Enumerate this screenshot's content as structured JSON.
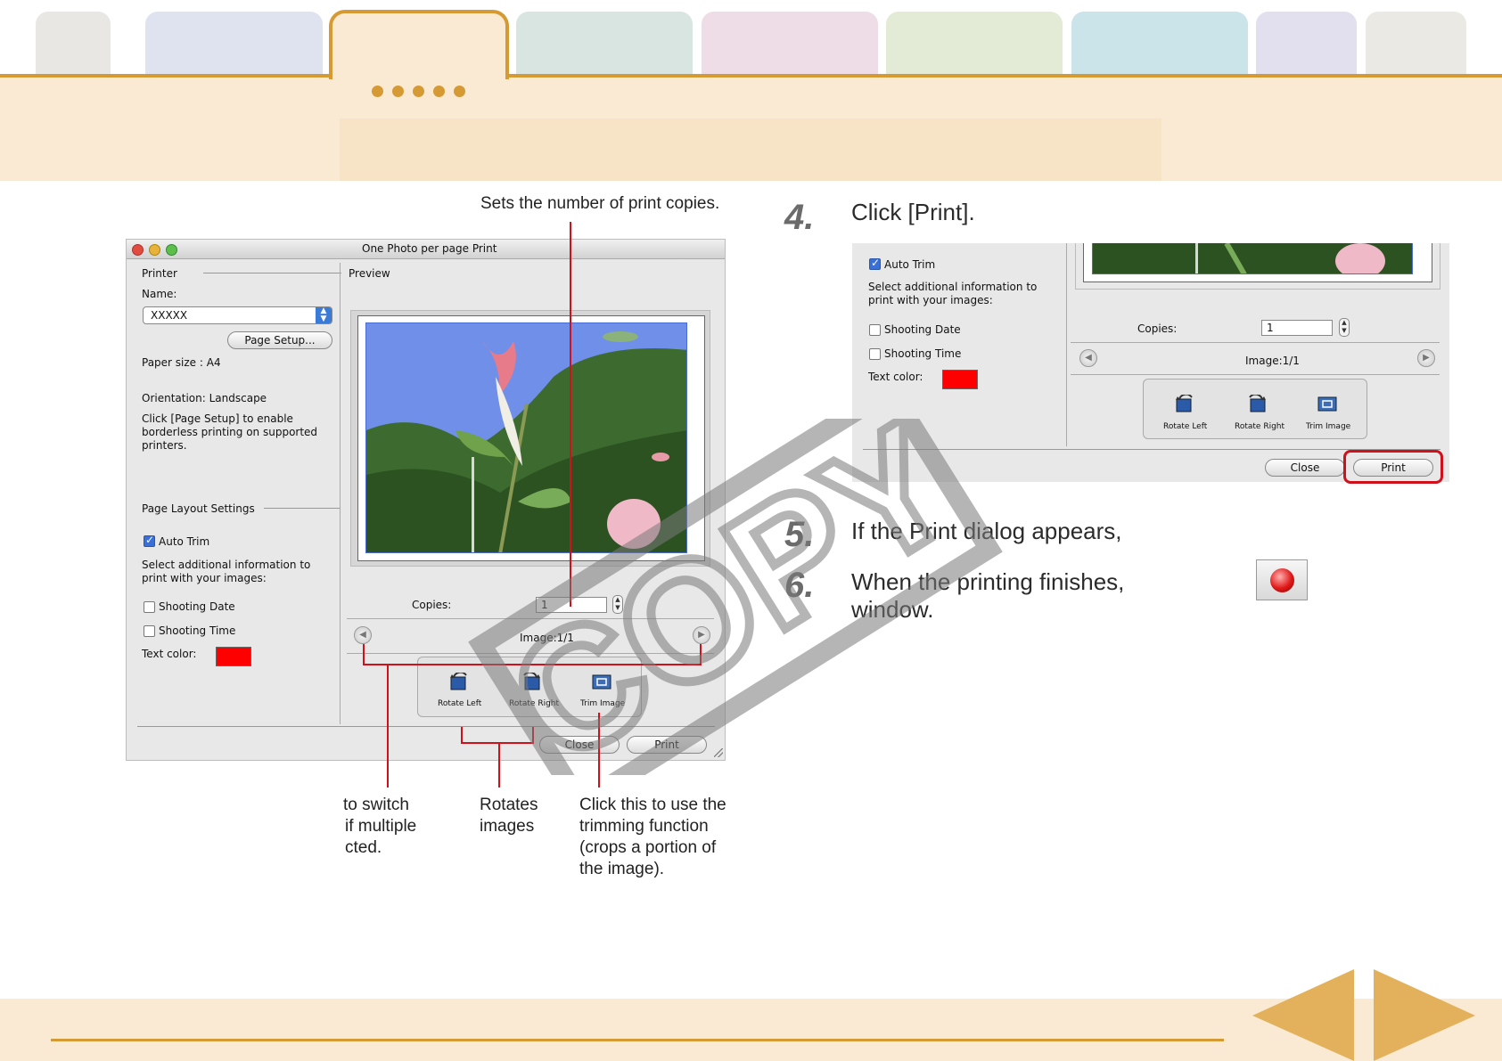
{
  "header": {
    "tabs": [
      {
        "name": "tab-1",
        "color": "#e9e7e3"
      },
      {
        "name": "tab-2",
        "color": "#dfe3ef"
      },
      {
        "name": "tab-active",
        "color": "#faead4"
      },
      {
        "name": "tab-4",
        "color": "#d8e5e0"
      },
      {
        "name": "tab-5",
        "color": "#eedde7"
      },
      {
        "name": "tab-6",
        "color": "#e3ead6"
      },
      {
        "name": "tab-7",
        "color": "#cbe4ea"
      },
      {
        "name": "tab-8",
        "color": "#e2e0ee"
      },
      {
        "name": "tab-9",
        "color": "#ebe9e3"
      }
    ],
    "accent": "#d69a34"
  },
  "dialog": {
    "title": "One Photo per page Print",
    "printer_section": "Printer",
    "name_label": "Name:",
    "printer_value": "XXXXX",
    "page_setup_button": "Page Setup...",
    "paper_size": "Paper size :  A4",
    "orientation": "Orientation: Landscape",
    "borderless_note": "Click [Page Setup] to enable borderless printing on supported printers.",
    "layout_section": "Page Layout Settings",
    "auto_trim": "Auto Trim",
    "additional_info": "Select additional information to print with your images:",
    "shooting_date": "Shooting Date",
    "shooting_time": "Shooting Time",
    "text_color": "Text color:",
    "preview_label": "Preview",
    "copies_label": "Copies:",
    "copies_value": "1",
    "image_counter": "Image:1/1",
    "rotate_left": "Rotate Left",
    "rotate_right": "Rotate Right",
    "trim_image": "Trim Image",
    "close_button": "Close",
    "print_button": "Print"
  },
  "callouts": {
    "copies": "Sets the number of print copies.",
    "switch_line1": "to switch",
    "switch_line2": "if multiple",
    "switch_line3": "cted.",
    "rotates_line1": "Rotates",
    "rotates_line2": "images",
    "trim_line1": "Click this to use the",
    "trim_line2": "trimming function",
    "trim_line3": "(crops a portion of",
    "trim_line4": "the image)."
  },
  "steps": [
    {
      "num": "4.",
      "text": "Click [Print]."
    },
    {
      "num": "5.",
      "text": "If the Print dialog appears,"
    },
    {
      "num": "6.",
      "text_line1": "When the printing finishes,",
      "text_line2": "window."
    }
  ],
  "watermark": "COPY"
}
